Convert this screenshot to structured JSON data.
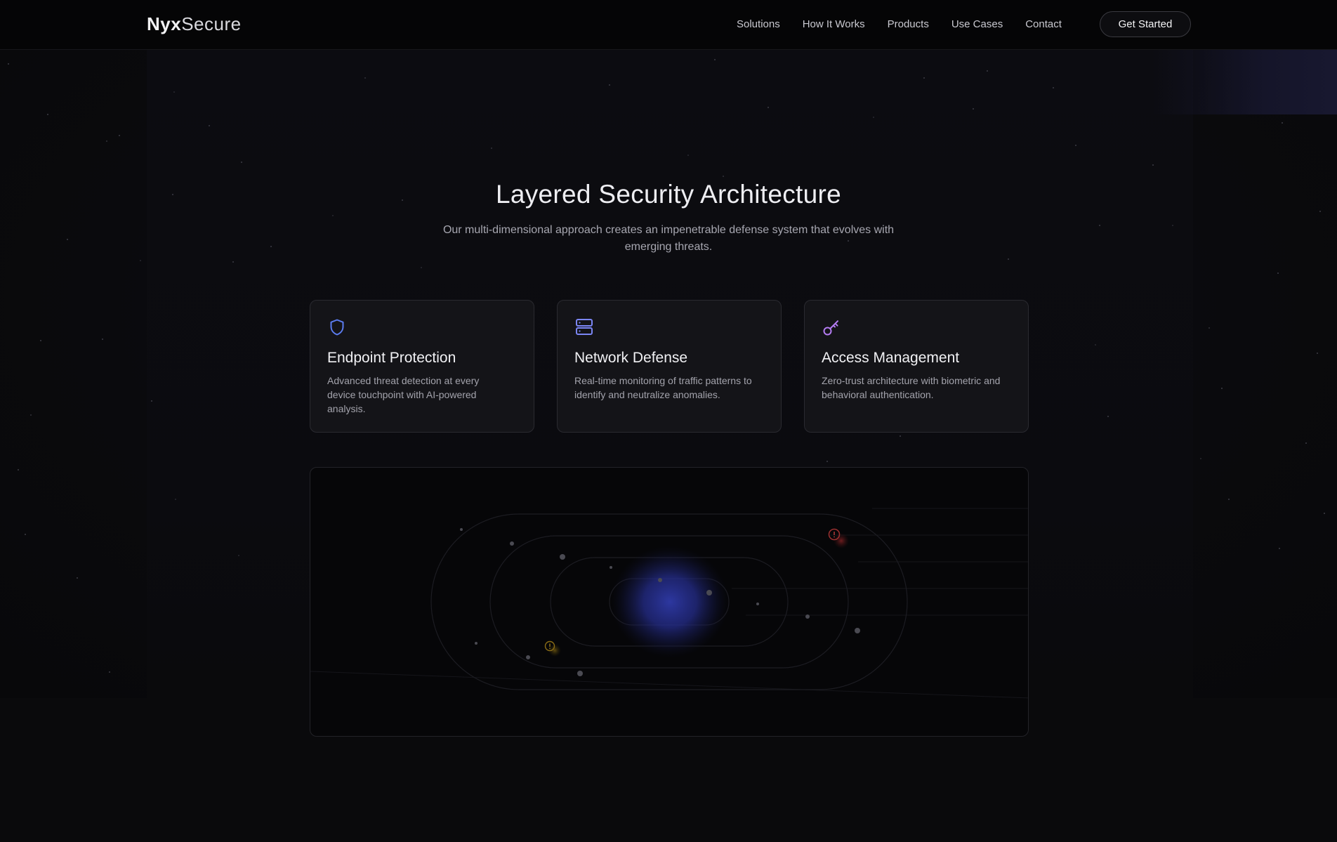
{
  "brand": {
    "bold": "Nyx",
    "light": "Secure"
  },
  "nav": {
    "items": [
      "Solutions",
      "How It Works",
      "Products",
      "Use Cases",
      "Contact"
    ],
    "cta": "Get Started"
  },
  "hero": {
    "title": "Layered Security Architecture",
    "subtitle": "Our multi-dimensional approach creates an impenetrable defense system that evolves with emerging threats."
  },
  "cards": [
    {
      "icon": "shield-icon",
      "icon_color": "#5b7cf0",
      "title": "Endpoint Protection",
      "text": "Advanced threat detection at every device touchpoint with AI-powered analysis."
    },
    {
      "icon": "server-icon",
      "icon_color": "#7b86f5",
      "title": "Network Defense",
      "text": "Real-time monitoring of traffic patterns to identify and neutralize anomalies."
    },
    {
      "icon": "key-icon",
      "icon_color": "#b47cf2",
      "title": "Access Management",
      "text": "Zero-trust architecture with biometric and behavioral authentication."
    }
  ],
  "colors": {
    "accent": "#3a45c8",
    "threat_high": "#c43c3c",
    "threat_medium": "#b08a1a"
  }
}
